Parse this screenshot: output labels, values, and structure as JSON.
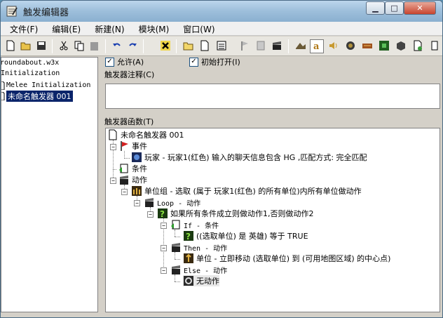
{
  "window": {
    "title": "触发编辑器"
  },
  "menu": [
    {
      "label": "文件(F)"
    },
    {
      "label": "编辑(E)"
    },
    {
      "label": "新建(N)"
    },
    {
      "label": "模块(M)"
    },
    {
      "label": "窗口(W)"
    }
  ],
  "toolbar": {
    "buttons": [
      "new-icon",
      "open-icon",
      "save-icon",
      "cut-icon",
      "copy-icon",
      "paste-icon",
      "undo-icon",
      "redo-icon",
      "delete-icon",
      "new-category-icon",
      "new-trigger-icon",
      "new-comment-icon",
      "new-event-icon",
      "new-condition-icon",
      "new-action-icon",
      "terrain-editor-icon",
      "trigger-editor-icon",
      "sound-editor-icon",
      "object-editor-icon",
      "campaign-editor-icon",
      "ai-editor-icon",
      "object-manager-icon",
      "import-manager-icon"
    ]
  },
  "left_panel": {
    "items": [
      {
        "label": "roundabout.w3x"
      },
      {
        "label": "Initialization"
      },
      {
        "label": "Melee Initialization"
      },
      {
        "label": "未命名触发器 001",
        "selected": true
      }
    ]
  },
  "trigger": {
    "enabled_label": "允许(A)",
    "enabled": true,
    "initially_on_label": "初始打开(I)",
    "initially_on": true,
    "comment_label": "触发器注释(C)",
    "comment": "",
    "functions_label": "触发器函数(T)"
  },
  "tree": {
    "root": "未命名触发器 001",
    "events_label": "事件",
    "event_1": "玩家 - 玩家1(红色) 输入的聊天信息包含 HG ,匹配方式: 完全匹配",
    "conditions_label": "条件",
    "actions_label": "动作",
    "action_1": "单位组 - 选取 (属于 玩家1(红色) 的所有单位)内所有单位做动作",
    "loop_label": "Loop - 动作",
    "if_then_else": "如果所有条件成立则做动作1,否则做动作2",
    "if_label": "If - 条件",
    "if_condition": "((选取单位) 是 英雄) 等于 TRUE",
    "then_label": "Then - 动作",
    "then_action": "单位 - 立即移动 (选取单位) 到 (可用地图区域) 的中心点)",
    "else_label": "Else - 动作",
    "else_action": "无动作"
  }
}
